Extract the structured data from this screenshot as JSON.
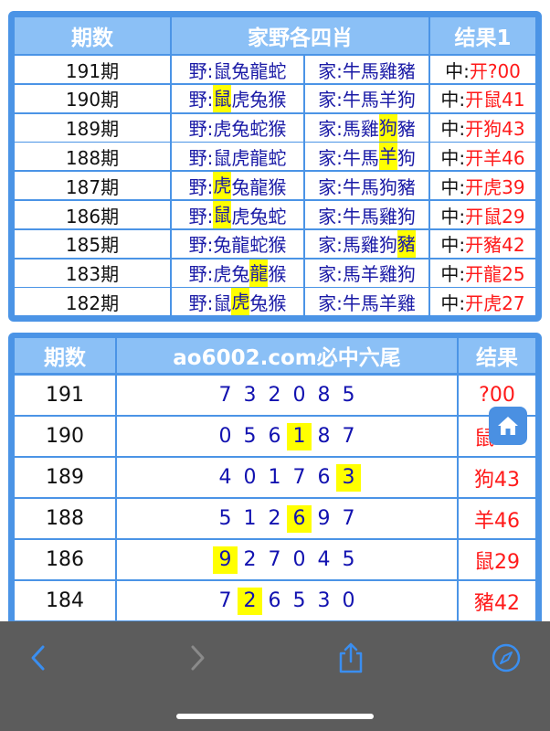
{
  "table1": {
    "headers": [
      "期数",
      "家野各四肖",
      "结果1"
    ],
    "rows": [
      {
        "issue": "191期",
        "wild_prefix": "野:",
        "wild": [
          "鼠",
          "兔",
          "龍",
          "蛇"
        ],
        "wild_hl": -1,
        "home_prefix": "家:",
        "home": [
          "牛",
          "馬",
          "雞",
          "豬"
        ],
        "home_hl": -1,
        "res_prefix": "中:",
        "res": "开?00"
      },
      {
        "issue": "190期",
        "wild_prefix": "野:",
        "wild": [
          "鼠",
          "虎",
          "兔",
          "猴"
        ],
        "wild_hl": 0,
        "home_prefix": "家:",
        "home": [
          "牛",
          "馬",
          "羊",
          "狗"
        ],
        "home_hl": -1,
        "res_prefix": "中:",
        "res": "开鼠41"
      },
      {
        "issue": "189期",
        "wild_prefix": "野:",
        "wild": [
          "虎",
          "兔",
          "蛇",
          "猴"
        ],
        "wild_hl": -1,
        "home_prefix": "家:",
        "home": [
          "馬",
          "雞",
          "狗",
          "豬"
        ],
        "home_hl": 2,
        "res_prefix": "中:",
        "res": "开狗43"
      },
      {
        "issue": "188期",
        "wild_prefix": "野:",
        "wild": [
          "鼠",
          "虎",
          "龍",
          "蛇"
        ],
        "wild_hl": -1,
        "home_prefix": "家:",
        "home": [
          "牛",
          "馬",
          "羊",
          "狗"
        ],
        "home_hl": 2,
        "res_prefix": "中:",
        "res": "开羊46"
      },
      {
        "issue": "187期",
        "wild_prefix": "野:",
        "wild": [
          "虎",
          "兔",
          "龍",
          "猴"
        ],
        "wild_hl": 0,
        "home_prefix": "家:",
        "home": [
          "牛",
          "馬",
          "狗",
          "豬"
        ],
        "home_hl": -1,
        "res_prefix": "中:",
        "res": "开虎39"
      },
      {
        "issue": "186期",
        "wild_prefix": "野:",
        "wild": [
          "鼠",
          "虎",
          "兔",
          "蛇"
        ],
        "wild_hl": 0,
        "home_prefix": "家:",
        "home": [
          "牛",
          "馬",
          "雞",
          "狗"
        ],
        "home_hl": -1,
        "res_prefix": "中:",
        "res": "开鼠29"
      },
      {
        "issue": "185期",
        "wild_prefix": "野:",
        "wild": [
          "兔",
          "龍",
          "蛇",
          "猴"
        ],
        "wild_hl": -1,
        "home_prefix": "家:",
        "home": [
          "馬",
          "雞",
          "狗",
          "豬"
        ],
        "home_hl": 3,
        "res_prefix": "中:",
        "res": "开豬42"
      },
      {
        "issue": "183期",
        "wild_prefix": "野:",
        "wild": [
          "虎",
          "兔",
          "龍",
          "猴"
        ],
        "wild_hl": 2,
        "home_prefix": "家:",
        "home": [
          "馬",
          "羊",
          "雞",
          "狗"
        ],
        "home_hl": -1,
        "res_prefix": "中:",
        "res": "开龍25"
      },
      {
        "issue": "182期",
        "wild_prefix": "野:",
        "wild": [
          "鼠",
          "虎",
          "兔",
          "猴"
        ],
        "wild_hl": 1,
        "home_prefix": "家:",
        "home": [
          "牛",
          "馬",
          "羊",
          "雞"
        ],
        "home_hl": -1,
        "res_prefix": "中:",
        "res": "开虎27"
      }
    ]
  },
  "table2": {
    "headers": [
      "期数",
      "ao6002.com必中六尾",
      "结果"
    ],
    "rows": [
      {
        "issue": "191",
        "digits": [
          "7",
          "3",
          "2",
          "0",
          "8",
          "5"
        ],
        "hl": -1,
        "res": "?00"
      },
      {
        "issue": "190",
        "digits": [
          "0",
          "5",
          "6",
          "1",
          "8",
          "7"
        ],
        "hl": 3,
        "res": "鼠41"
      },
      {
        "issue": "189",
        "digits": [
          "4",
          "0",
          "1",
          "7",
          "6",
          "3"
        ],
        "hl": 5,
        "res": "狗43"
      },
      {
        "issue": "188",
        "digits": [
          "5",
          "1",
          "2",
          "6",
          "9",
          "7"
        ],
        "hl": 3,
        "res": "羊46"
      },
      {
        "issue": "186",
        "digits": [
          "9",
          "2",
          "7",
          "0",
          "4",
          "5"
        ],
        "hl": 0,
        "res": "鼠29"
      },
      {
        "issue": "184",
        "digits": [
          "7",
          "2",
          "6",
          "5",
          "3",
          "0"
        ],
        "hl": 1,
        "res": "豬42"
      }
    ]
  },
  "toolbar": {
    "icons": [
      "back-chevron-icon",
      "forward-chevron-icon",
      "share-icon",
      "compass-icon",
      "home-icon"
    ]
  },
  "colors": {
    "panel": "#4b94e6",
    "header": "#8bc0f6",
    "highlight": "#ffff00",
    "result_red": "#ff1a1a",
    "digits": "#1212b0"
  }
}
